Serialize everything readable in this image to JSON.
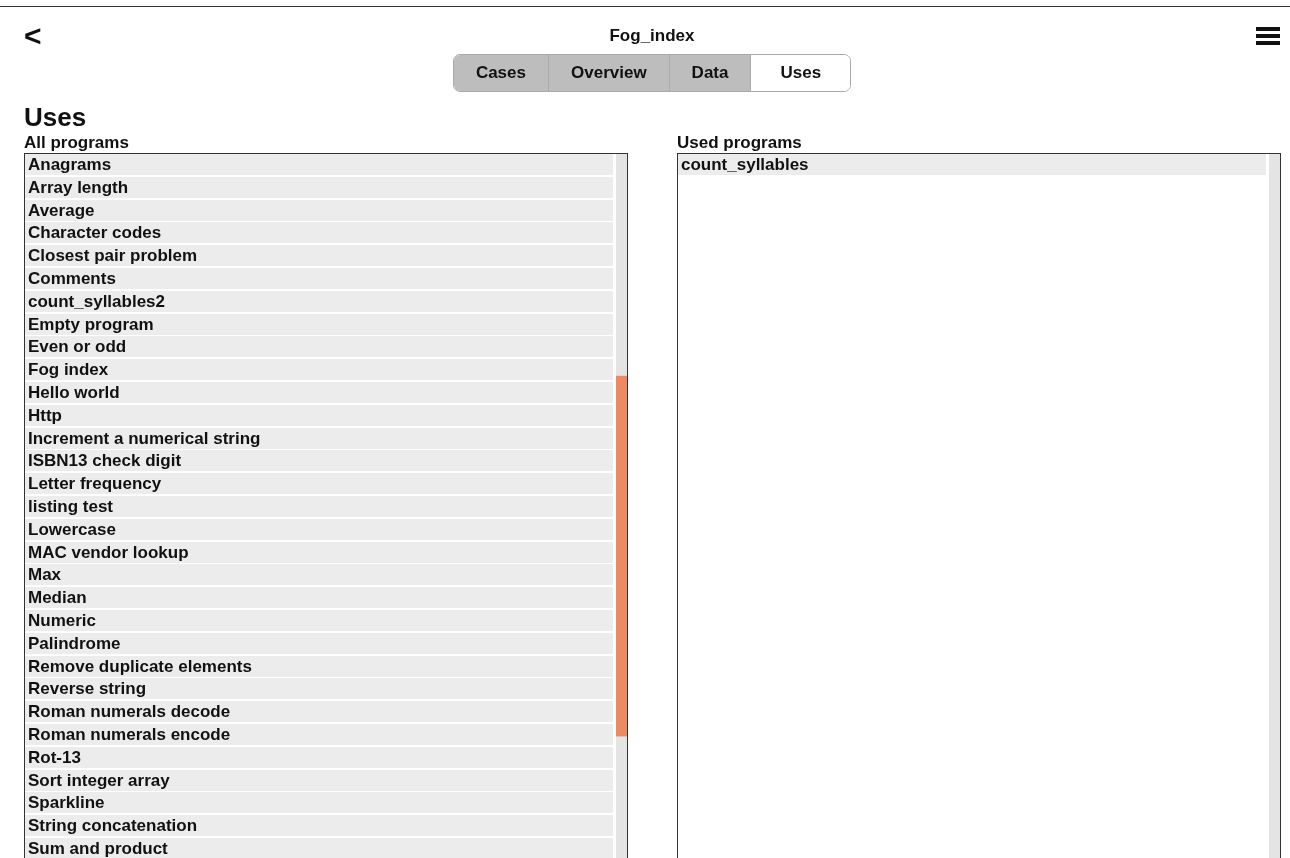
{
  "header": {
    "back": "<",
    "title": "Fog_index"
  },
  "tabs": [
    {
      "label": "Cases",
      "selected": false
    },
    {
      "label": "Overview",
      "selected": false
    },
    {
      "label": "Data",
      "selected": false
    },
    {
      "label": "Uses",
      "selected": true
    }
  ],
  "heading": "Uses",
  "all_programs": {
    "label": "All programs",
    "items": [
      "Anagrams",
      "Array length",
      "Average",
      "Character codes",
      "Closest pair problem",
      "Comments",
      "count_syllables2",
      "Empty program",
      "Even or odd",
      "Fog index",
      "Hello world",
      "Http",
      "Increment a numerical string",
      "ISBN13 check digit",
      "Letter frequency",
      "listing test",
      "Lowercase",
      "MAC vendor lookup",
      "Max",
      "Median",
      "Numeric",
      "Palindrome",
      "Remove duplicate elements",
      "Reverse string",
      "Roman numerals decode",
      "Roman numerals encode",
      "Rot-13",
      "Sort integer array",
      "Sparkline",
      "String concatenation",
      "Sum and product"
    ]
  },
  "used_programs": {
    "label": "Used programs",
    "items": [
      "count_syllables"
    ]
  }
}
